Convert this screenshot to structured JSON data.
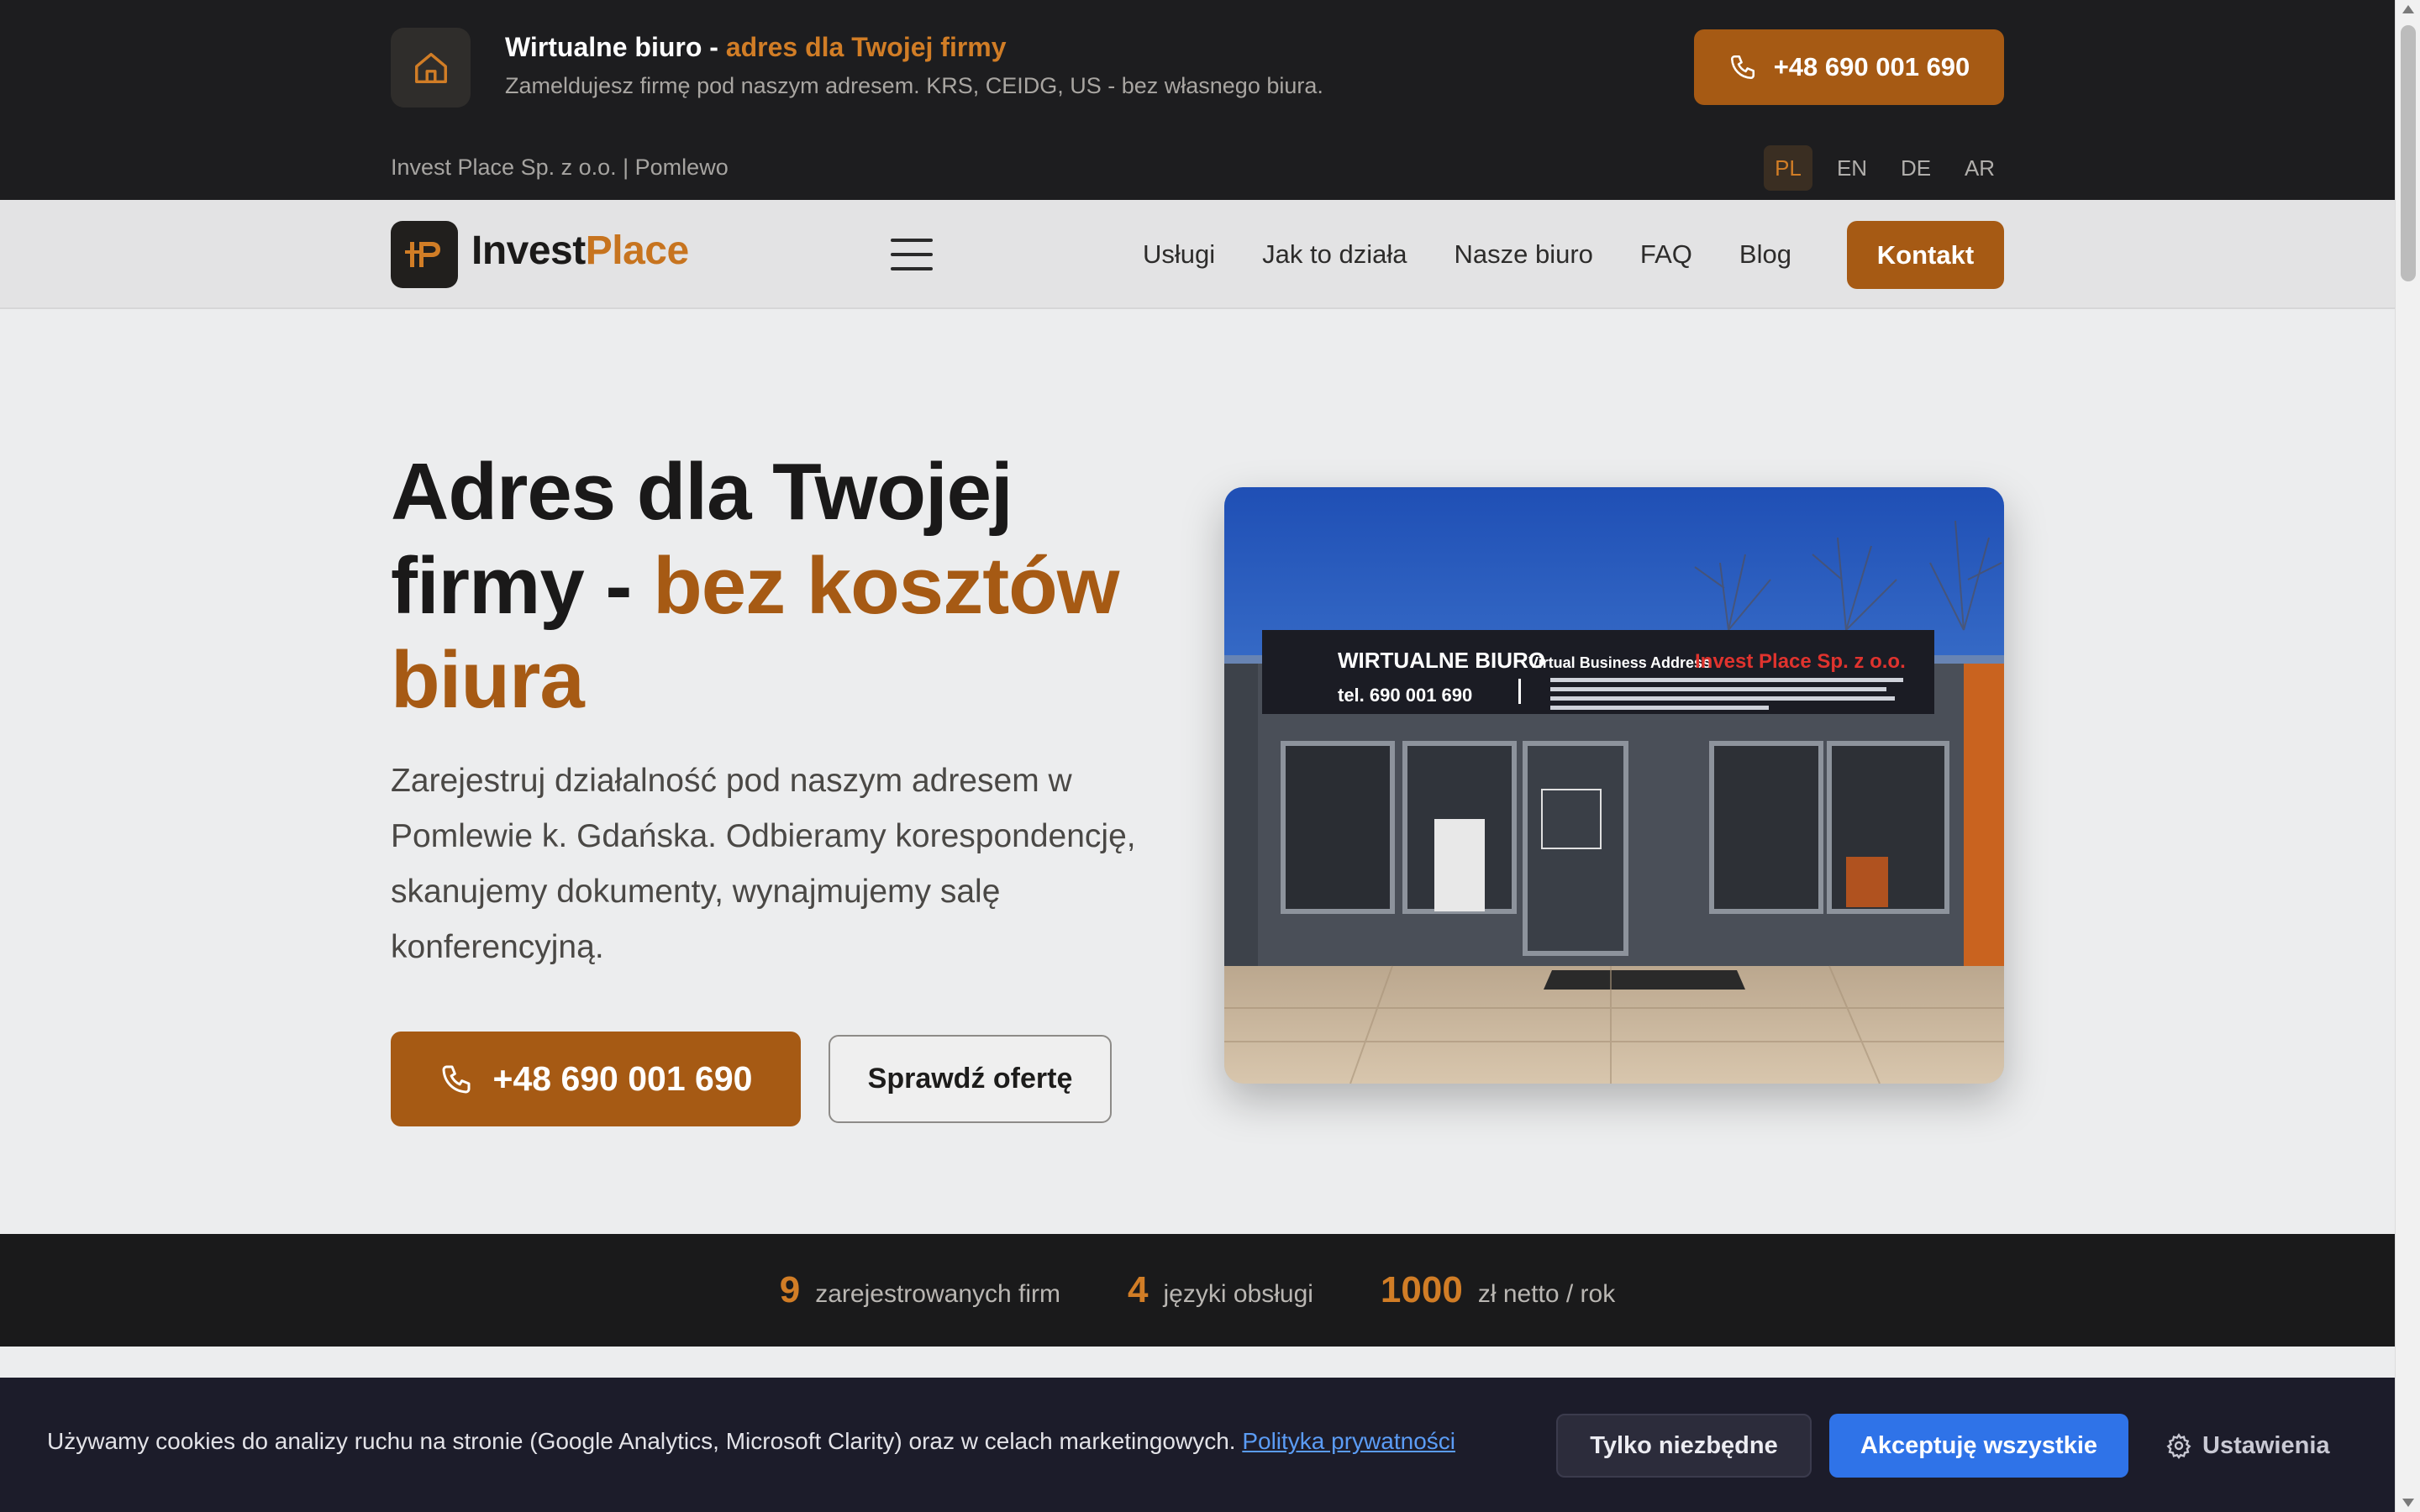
{
  "colors": {
    "accent": "#d17d26",
    "accent_dark": "#a65a14",
    "topbar_bg": "#1d1d1f",
    "cookie_accept": "#2f73e8"
  },
  "topbar": {
    "home_icon": "home-icon",
    "title": "Wirtualne biuro - ",
    "title_accent": "adres dla Twojej firmy",
    "subtitle": "Zameldujesz firmę pod naszym adresem. KRS, CEIDG, US - bez własnego biura.",
    "phone_icon": "phone-icon",
    "phone": "+48 690 001 690",
    "company": "Invest Place Sp. z o.o. | Pomlewo",
    "languages": [
      "PL",
      "EN",
      "DE",
      "AR"
    ],
    "active_language": "PL"
  },
  "nav": {
    "logo_text": "Invest",
    "logo_accent": "Place",
    "menu_icon": "hamburger-menu-icon",
    "links": [
      "Usługi",
      "Jak to działa",
      "Nasze biuro",
      "FAQ",
      "Blog"
    ],
    "cta": "Kontakt"
  },
  "hero": {
    "title_line1": "Adres dla Twojej",
    "title_line2": "firmy - ",
    "title_accent": "bez kosztów biura",
    "description": "Zarejestruj działalność pod naszym adresem w Pomlewie k. Gdańska. Odbieramy korespondencję, skanujemy dokumenty, wynajmujemy salę konferencyjną.",
    "phone_button": "+48 690 001 690",
    "offer_button": "Sprawdź ofertę",
    "photo": {
      "sign_title": "WIRTUALNE BIURO",
      "sign_sub": "Virtual Business Address",
      "sign_brand": "Invest Place Sp. z o.o.",
      "sign_phone": "tel. 690 001 690"
    }
  },
  "stats": [
    {
      "value": "9",
      "label": "zarejestrowanych firm"
    },
    {
      "value": "4",
      "label": "języki obsługi"
    },
    {
      "value": "1000",
      "label": "zł netto / rok"
    }
  ],
  "cookie": {
    "text": "Używamy cookies do analizy ruchu na stronie (Google Analytics, Microsoft Clarity) oraz w celach marketingowych.",
    "policy_link": "Polityka prywatności",
    "essential_button": "Tylko niezbędne",
    "accept_button": "Akceptuję wszystkie",
    "settings_icon": "gear-icon",
    "settings_button": "Ustawienia"
  }
}
